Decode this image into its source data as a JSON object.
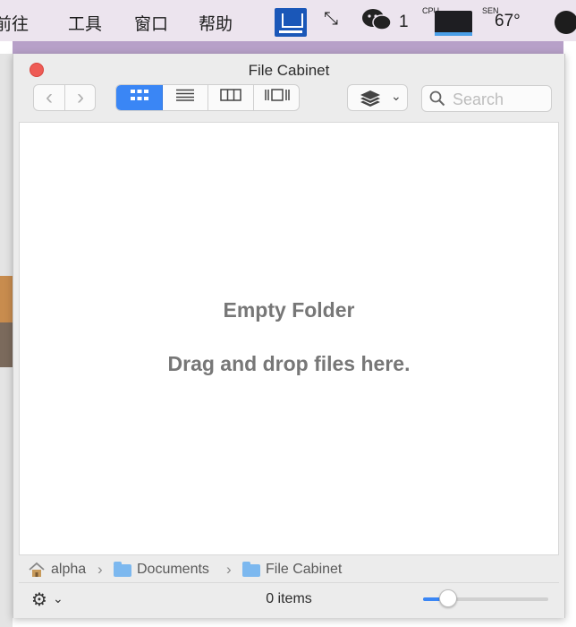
{
  "menubar": {
    "items": [
      "前往",
      "工具",
      "窗口",
      "帮助"
    ],
    "wechat_count": "1",
    "cpu_label": "CPU",
    "sen_label": "SEN",
    "temperature": "67°"
  },
  "window": {
    "title": "File Cabinet"
  },
  "toolbar": {
    "back": "‹",
    "forward": "›",
    "view_modes": [
      "icon-view",
      "list-view",
      "column-view",
      "gallery-view"
    ],
    "active_view": "icon-view",
    "search_placeholder": "Search"
  },
  "content": {
    "empty_title": "Empty Folder",
    "empty_subtitle": "Drag and drop files here."
  },
  "pathbar": {
    "crumbs": [
      "alpha",
      "Documents",
      "File Cabinet"
    ]
  },
  "status": {
    "items_text": "0 items",
    "zoom_fraction": 0.15
  },
  "colors": {
    "accent": "#3a86f5",
    "close": "#ee5b55",
    "folder": "#7cb8ef"
  }
}
